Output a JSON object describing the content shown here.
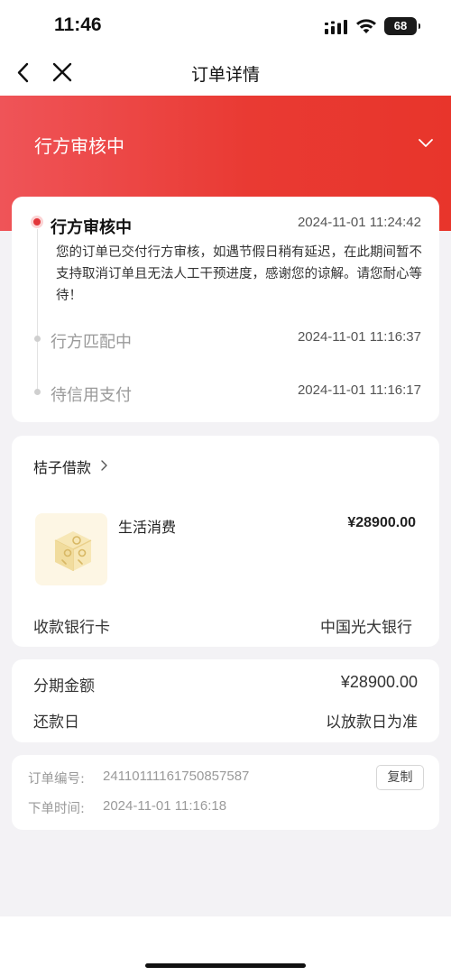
{
  "status_bar": {
    "time": "11:46",
    "battery": "68"
  },
  "nav": {
    "title": "订单详情"
  },
  "header": {
    "status": "行方审核中"
  },
  "timeline": [
    {
      "title": "行方审核中",
      "time": "2024-11-01 11:24:42",
      "desc": "您的订单已交付行方审核，如遇节假日稍有延迟，在此期间暂不支持取消订单且无法人工干预进度，感谢您的谅解。请您耐心等待！"
    },
    {
      "title": "行方匹配中",
      "time": "2024-11-01 11:16:37"
    },
    {
      "title": "待信用支付",
      "time": "2024-11-01 11:16:17"
    }
  ],
  "loan": {
    "lender": "桔子借款",
    "product_name": "生活消费",
    "amount": "¥28900.00",
    "bank_label": "收款银行卡",
    "bank_value": "中国光大银行"
  },
  "installment": {
    "amount_label": "分期金额",
    "amount_value": "¥28900.00",
    "repay_label": "还款日",
    "repay_value": "以放款日为准"
  },
  "order": {
    "number_label": "订单编号:",
    "number_value": "24110111161750857587",
    "time_label": "下单时间:",
    "time_value": "2024-11-01 11:16:18",
    "copy_label": "复制"
  },
  "colors": {
    "accent": "#e8352b",
    "background": "#f3f2f5"
  }
}
